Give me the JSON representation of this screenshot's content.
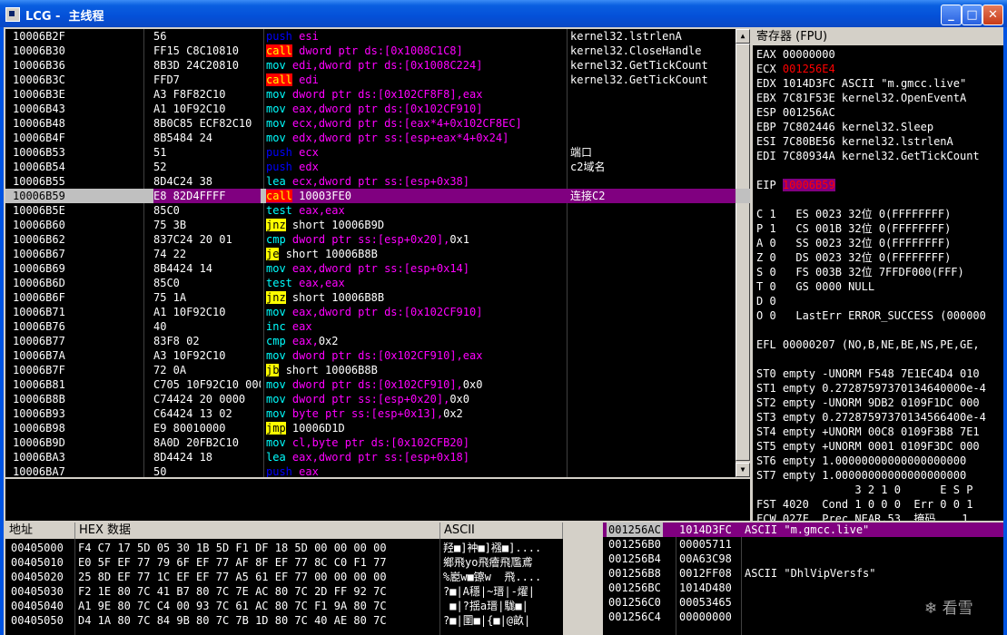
{
  "window": {
    "title": "LCG -  主线程",
    "minimize": "_",
    "maximize": "□",
    "close": "✕"
  },
  "disasm": [
    {
      "addr": "10006B2F",
      "hex": "56",
      "mn": "push",
      "type": "push",
      "ops": [
        [
          "esi",
          "op"
        ]
      ],
      "cmt": "kernel32.lstrlenA"
    },
    {
      "addr": "10006B30",
      "hex": "FF15 C8C10810",
      "mn": "call",
      "type": "call",
      "ops": [
        [
          "dword ptr ds:[0x1008C1C8]",
          "op"
        ]
      ],
      "cmt": "kernel32.CloseHandle"
    },
    {
      "addr": "10006B36",
      "hex": "8B3D 24C20810",
      "mn": "mov",
      "type": "def",
      "ops": [
        [
          "edi,dword ptr ds:[0x1008C224]",
          "op"
        ]
      ],
      "cmt": "kernel32.GetTickCount"
    },
    {
      "addr": "10006B3C",
      "hex": "FFD7",
      "mn": "call",
      "type": "call",
      "ops": [
        [
          "edi",
          "op"
        ]
      ],
      "cmt": "kernel32.GetTickCount"
    },
    {
      "addr": "10006B3E",
      "hex": "A3 F8F82C10",
      "mn": "mov",
      "type": "def",
      "ops": [
        [
          "dword ptr ds:[0x102CF8F8],eax",
          "op"
        ]
      ],
      "cmt": ""
    },
    {
      "addr": "10006B43",
      "hex": "A1 10F92C10",
      "mn": "mov",
      "type": "def",
      "ops": [
        [
          "eax,dword ptr ds:[0x102CF910]",
          "op"
        ]
      ],
      "cmt": ""
    },
    {
      "addr": "10006B48",
      "hex": "8B0C85 ECF82C10",
      "mn": "mov",
      "type": "def",
      "ops": [
        [
          "ecx,dword ptr ds:[eax*4+0x102CF8EC]",
          "op"
        ]
      ],
      "cmt": ""
    },
    {
      "addr": "10006B4F",
      "hex": "8B5484 24",
      "mn": "mov",
      "type": "def",
      "ops": [
        [
          "edx,dword ptr ss:[esp+eax*4+0x24]",
          "op"
        ]
      ],
      "cmt": ""
    },
    {
      "addr": "10006B53",
      "hex": "51",
      "mn": "push",
      "type": "push",
      "ops": [
        [
          "ecx",
          "op"
        ]
      ],
      "cmt": "端口"
    },
    {
      "addr": "10006B54",
      "hex": "52",
      "mn": "push",
      "type": "push",
      "ops": [
        [
          "edx",
          "op"
        ]
      ],
      "cmt": "c2域名"
    },
    {
      "addr": "10006B55",
      "hex": "8D4C24 38",
      "mn": "lea",
      "type": "def",
      "ops": [
        [
          "ecx,dword ptr ss:[esp+0x38]",
          "op"
        ]
      ],
      "cmt": ""
    },
    {
      "addr": "10006B59",
      "hex": "E8 82D4FFFF",
      "mn": "call",
      "type": "call",
      "ops": [
        [
          "10003FE0",
          "opw"
        ]
      ],
      "cmt": "连接C2",
      "selected": true
    },
    {
      "addr": "10006B5E",
      "hex": "85C0",
      "mn": "test",
      "type": "def",
      "ops": [
        [
          "eax,eax",
          "op"
        ]
      ],
      "cmt": ""
    },
    {
      "addr": "10006B60",
      "hex": "75 3B",
      "mn": "jnz",
      "type": "jmp",
      "ops": [
        [
          "short 10006B9D",
          "opw"
        ]
      ],
      "cmt": ""
    },
    {
      "addr": "10006B62",
      "hex": "837C24 20 01",
      "mn": "cmp",
      "type": "def",
      "ops": [
        [
          "dword ptr ss:[esp+0x20],",
          "op"
        ],
        [
          "0x1",
          "opw"
        ]
      ],
      "cmt": ""
    },
    {
      "addr": "10006B67",
      "hex": "74 22",
      "mn": "je",
      "type": "jmp",
      "ops": [
        [
          "short 10006B8B",
          "opw"
        ]
      ],
      "cmt": ""
    },
    {
      "addr": "10006B69",
      "hex": "8B4424 14",
      "mn": "mov",
      "type": "def",
      "ops": [
        [
          "eax,dword ptr ss:[esp+0x14]",
          "op"
        ]
      ],
      "cmt": ""
    },
    {
      "addr": "10006B6D",
      "hex": "85C0",
      "mn": "test",
      "type": "def",
      "ops": [
        [
          "eax,eax",
          "op"
        ]
      ],
      "cmt": ""
    },
    {
      "addr": "10006B6F",
      "hex": "75 1A",
      "mn": "jnz",
      "type": "jmp",
      "ops": [
        [
          "short 10006B8B",
          "opw"
        ]
      ],
      "cmt": ""
    },
    {
      "addr": "10006B71",
      "hex": "A1 10F92C10",
      "mn": "mov",
      "type": "def",
      "ops": [
        [
          "eax,dword ptr ds:[0x102CF910]",
          "op"
        ]
      ],
      "cmt": ""
    },
    {
      "addr": "10006B76",
      "hex": "40",
      "mn": "inc",
      "type": "def",
      "ops": [
        [
          "eax",
          "op"
        ]
      ],
      "cmt": ""
    },
    {
      "addr": "10006B77",
      "hex": "83F8 02",
      "mn": "cmp",
      "type": "def",
      "ops": [
        [
          "eax,",
          "op"
        ],
        [
          "0x2",
          "opw"
        ]
      ],
      "cmt": ""
    },
    {
      "addr": "10006B7A",
      "hex": "A3 10F92C10",
      "mn": "mov",
      "type": "def",
      "ops": [
        [
          "dword ptr ds:[0x102CF910],eax",
          "op"
        ]
      ],
      "cmt": ""
    },
    {
      "addr": "10006B7F",
      "hex": "72 0A",
      "mn": "jb",
      "type": "jmp",
      "ops": [
        [
          "short 10006B8B",
          "opw"
        ]
      ],
      "cmt": ""
    },
    {
      "addr": "10006B81",
      "hex": "C705 10F92C10 0000",
      "mn": "mov",
      "type": "def",
      "ops": [
        [
          "dword ptr ds:[0x102CF910],",
          "op"
        ],
        [
          "0x0",
          "opw"
        ]
      ],
      "cmt": ""
    },
    {
      "addr": "10006B8B",
      "hex": "C74424 20 0000",
      "mn": "mov",
      "type": "def",
      "ops": [
        [
          "dword ptr ss:[esp+0x20],",
          "op"
        ],
        [
          "0x0",
          "opw"
        ]
      ],
      "cmt": ""
    },
    {
      "addr": "10006B93",
      "hex": "C64424 13 02",
      "mn": "mov",
      "type": "def",
      "ops": [
        [
          "byte ptr ss:[esp+0x13],",
          "op"
        ],
        [
          "0x2",
          "opw"
        ]
      ],
      "cmt": ""
    },
    {
      "addr": "10006B98",
      "hex": "E9 80010000",
      "mn": "jmp",
      "type": "jmp",
      "ops": [
        [
          "10006D1D",
          "opw"
        ]
      ],
      "cmt": ""
    },
    {
      "addr": "10006B9D",
      "hex": "8A0D 20FB2C10",
      "mn": "mov",
      "type": "def",
      "ops": [
        [
          "cl,byte ptr ds:[0x102CFB20]",
          "op"
        ]
      ],
      "cmt": ""
    },
    {
      "addr": "10006BA3",
      "hex": "8D4424 18",
      "mn": "lea",
      "type": "def",
      "ops": [
        [
          "eax,dword ptr ss:[esp+0x18]",
          "op"
        ]
      ],
      "cmt": ""
    },
    {
      "addr": "10006BA7",
      "hex": "50",
      "mn": "push",
      "type": "push",
      "ops": [
        [
          "eax",
          "op"
        ]
      ],
      "cmt": ""
    }
  ],
  "registers": {
    "header": "寄存器 (FPU)",
    "lines": [
      {
        "t": "EAX 00000000"
      },
      {
        "t": "ECX ",
        "v": "001256E4",
        "red": true
      },
      {
        "t": "EDX 1014D3FC ASCII \"m.gmcc.live\""
      },
      {
        "t": "EBX 7C81F53E kernel32.OpenEventA"
      },
      {
        "t": "ESP 001256AC"
      },
      {
        "t": "EBP 7C802446 kernel32.Sleep"
      },
      {
        "t": "ESI 7C80BE56 kernel32.lstrlenA"
      },
      {
        "t": "EDI 7C80934A kernel32.GetTickCount"
      },
      {
        "t": ""
      },
      {
        "t": "EIP ",
        "v": "10006B59",
        "eip": true
      },
      {
        "t": ""
      },
      {
        "t": "C 1   ES 0023 32位 0(FFFFFFFF)"
      },
      {
        "t": "P 1   CS 001B 32位 0(FFFFFFFF)"
      },
      {
        "t": "A 0   SS 0023 32位 0(FFFFFFFF)"
      },
      {
        "t": "Z 0   DS 0023 32位 0(FFFFFFFF)"
      },
      {
        "t": "S 0   FS 003B 32位 7FFDF000(FFF)"
      },
      {
        "t": "T 0   GS 0000 NULL"
      },
      {
        "t": "D 0"
      },
      {
        "t": "O 0   LastErr ERROR_SUCCESS (000000"
      },
      {
        "t": ""
      },
      {
        "t": "EFL 00000207 (NO,B,NE,BE,NS,PE,GE,"
      },
      {
        "t": ""
      },
      {
        "t": "ST0 empty -UNORM F548 7E1EC4D4 010"
      },
      {
        "t": "ST1 empty 0.27287597370134640000e-4"
      },
      {
        "t": "ST2 empty -UNORM 9DB2 0109F1DC 000"
      },
      {
        "t": "ST3 empty 0.27287597370134566400e-4"
      },
      {
        "t": "ST4 empty +UNORM 00C8 0109F3B8 7E1"
      },
      {
        "t": "ST5 empty +UNORM 0001 0109F3DC 000"
      },
      {
        "t": "ST6 empty 1.00000000000000000000"
      },
      {
        "t": "ST7 empty 1.00000000000000000000"
      },
      {
        "t": "               3 2 1 0      E S P"
      },
      {
        "t": "FST 4020  Cond 1 0 0 0  Err 0 0 1"
      },
      {
        "t": "FCW 027F  Prec NEAR,53  掩码    1"
      }
    ]
  },
  "dump": {
    "headers": {
      "addr": "地址",
      "hex": "HEX 数据",
      "ascii": "ASCII"
    },
    "rows": [
      {
        "addr": "00405000",
        "hex": "F4 C7 17 5D 05 30 1B 5D F1 DF 18 5D 00 00 00 00",
        "ascii": "羟■]衶■]襁■]...."
      },
      {
        "addr": "00405010",
        "hex": "E0 5F EF 77 79 6F EF 77 AF 8F EF 77 8C C0 F1 77",
        "ascii": "鄉飛yo飛癐飛尶鳶"
      },
      {
        "addr": "00405020",
        "hex": "25 8D EF 77 1C EF EF 77 A5 61 EF 77 00 00 00 00",
        "ascii": "%嶏w■镲w  飛...."
      },
      {
        "addr": "00405030",
        "hex": "F2 1E 80 7C 41 B7 80 7C 7E AC 80 7C 2D FF 92 7C",
        "ascii": "?■|A穩|~瑨|-燿|"
      },
      {
        "addr": "00405040",
        "hex": "A1 9E 80 7C C4 00 93 7C 61 AC 80 7C F1 9A 80 7C",
        "ascii": " ■|?揺a瑨|駹■|"
      },
      {
        "addr": "00405050",
        "hex": "D4 1A 80 7C 84 9B 80 7C 7B 1D 80 7C 40 AE 80 7C",
        "ascii": "?■|圛■|{■|@畝|"
      }
    ]
  },
  "stack": [
    {
      "a": "001256AC",
      "v": "1014D3FC",
      "c": "ASCII \"m.gmcc.live\"",
      "sel": true
    },
    {
      "a": "001256B0",
      "v": "00005711",
      "c": ""
    },
    {
      "a": "001256B4",
      "v": "00A63C98",
      "c": ""
    },
    {
      "a": "001256B8",
      "v": "0012FF08",
      "c": "ASCII \"DhlVipVersfs\""
    },
    {
      "a": "001256BC",
      "v": "1014D480",
      "c": ""
    },
    {
      "a": "001256C0",
      "v": "00053465",
      "c": ""
    },
    {
      "a": "001256C4",
      "v": "00000000",
      "c": ""
    }
  ],
  "watermark": "看雪"
}
